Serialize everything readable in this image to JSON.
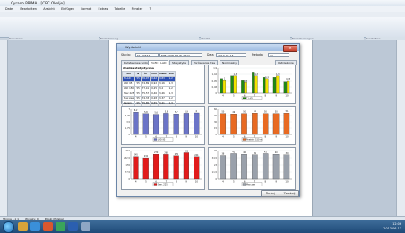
{
  "app": {
    "title": "Cyrano PRIMA - [CEC Okolje]",
    "menu": [
      "Datei",
      "Bearbeiten",
      "Ansicht",
      "Einfügen",
      "Format",
      "Extras",
      "Tabelle",
      "Fenster",
      "?"
    ],
    "ribbon_groups": [
      "Dokument",
      "Formatierung",
      "Absatz",
      "Formatvorlagen",
      "Bearbeiten"
    ]
  },
  "dialog": {
    "title": "Wyświetl",
    "station_label": "Stacja:",
    "station_value": "S1 00644",
    "station_name": "MIE 2008 DR-W 4 Sila",
    "date_label": "Data",
    "date_value": "2010-06-13",
    "method_label": "Metoda",
    "method_value": "Ari",
    "tabs": [
      "Podstawowe widoki",
      "Profil 1 LAD",
      "Statystyka",
      "Porównanie tras",
      "Nominalny"
    ],
    "extra_tab": "Ostrzeżenie",
    "table_title": "Analiza statystyczna",
    "table_headers": [
      "Zm",
      "N",
      "Śr",
      "Min",
      "Maks",
      "Std"
    ],
    "table_rows": [
      [
        "T LAD",
        "55",
        "76,07",
        "0,62",
        "3,83",
        "1,2"
      ],
      [
        "LAD 95",
        "55",
        "74,89",
        "0,92",
        "3,16",
        "1,3"
      ],
      [
        "LAD 150",
        "55",
        "77,41",
        "0,25",
        "3,2",
        "1,2"
      ],
      [
        "Szer 225",
        "55",
        "75,57",
        "0,46",
        "3,46",
        "1,3"
      ],
      [
        "Max zaw",
        "55",
        "74,33",
        "0,28",
        "3,37",
        "1,2"
      ],
      [
        "Razem",
        "55",
        "75,85",
        "0,55",
        "3,41",
        "1,3"
      ]
    ],
    "buttons": {
      "print": "Drukuj",
      "close": "Zamknij"
    },
    "legends": {
      "top_right": "T LAD",
      "mid_left": "LAD 95",
      "mid_right": "Powłoka 150 m",
      "bottom_left": "Szer. 225",
      "bottom_right": "Max zaw"
    }
  },
  "status": {
    "left": "Strona 1 z 1",
    "words": "Wyrazy: 0",
    "lang": "Polski (Polska)"
  },
  "clock": {
    "time": "12:06",
    "date": "2013-06-13"
  },
  "colors": {
    "green": "#1f8a12",
    "yellow": "#f2e300",
    "navy": "#2a2f72",
    "blue": "#6b74c7",
    "orange": "#e86a22",
    "red": "#e11b1b",
    "grey": "#9aa1ab",
    "highlight_row": "#2c4fb3"
  },
  "chart_data": [
    {
      "type": "bar",
      "name": "top-right",
      "categories": [
        "4",
        "5",
        "6",
        "7",
        "8",
        "9",
        "10"
      ],
      "series": [
        {
          "name": "T LAD",
          "values": [
            1.1,
            1.3,
            1.0,
            1.6,
            1.2,
            1.2,
            0.9
          ]
        },
        {
          "values": [
            1.0,
            1.3,
            0.8,
            1.3,
            1.1,
            1.3,
            0.95
          ]
        }
      ],
      "ylim": [
        0,
        1.9
      ]
    },
    {
      "type": "bar",
      "name": "mid-left",
      "categories": [
        "4",
        "5",
        "6",
        "7",
        "8",
        "9",
        "10"
      ],
      "series": [
        {
          "name": "LAD 95",
          "values": [
            6.2,
            5.8,
            5.6,
            5.9,
            5.7,
            5.9,
            6.0
          ]
        }
      ],
      "ylim": [
        0,
        7
      ]
    },
    {
      "type": "bar",
      "name": "mid-right",
      "categories": [
        "4",
        "5",
        "6",
        "7",
        "8",
        "9",
        "10"
      ],
      "series": [
        {
          "name": "Powłoka 150 m",
          "values": [
            50,
            49,
            50,
            51,
            50,
            50,
            51
          ]
        }
      ],
      "ylim": [
        0,
        60
      ]
    },
    {
      "type": "bar",
      "name": "bottom-left",
      "categories": [
        "4",
        "5",
        "6",
        "7",
        "8",
        "9",
        "10"
      ],
      "series": [
        {
          "name": "Szer. 225",
          "values": [
            245,
            232,
            270,
            268,
            254,
            286,
            244
          ]
        }
      ],
      "ylim": [
        0,
        310
      ]
    },
    {
      "type": "bar",
      "name": "bottom-right",
      "categories": [
        "4",
        "5",
        "6",
        "7",
        "8",
        "9",
        "10"
      ],
      "series": [
        {
          "name": "Max zaw",
          "values": [
            38,
            41,
            40,
            39,
            41,
            40,
            39
          ]
        }
      ],
      "ylim": [
        0,
        46
      ]
    }
  ]
}
